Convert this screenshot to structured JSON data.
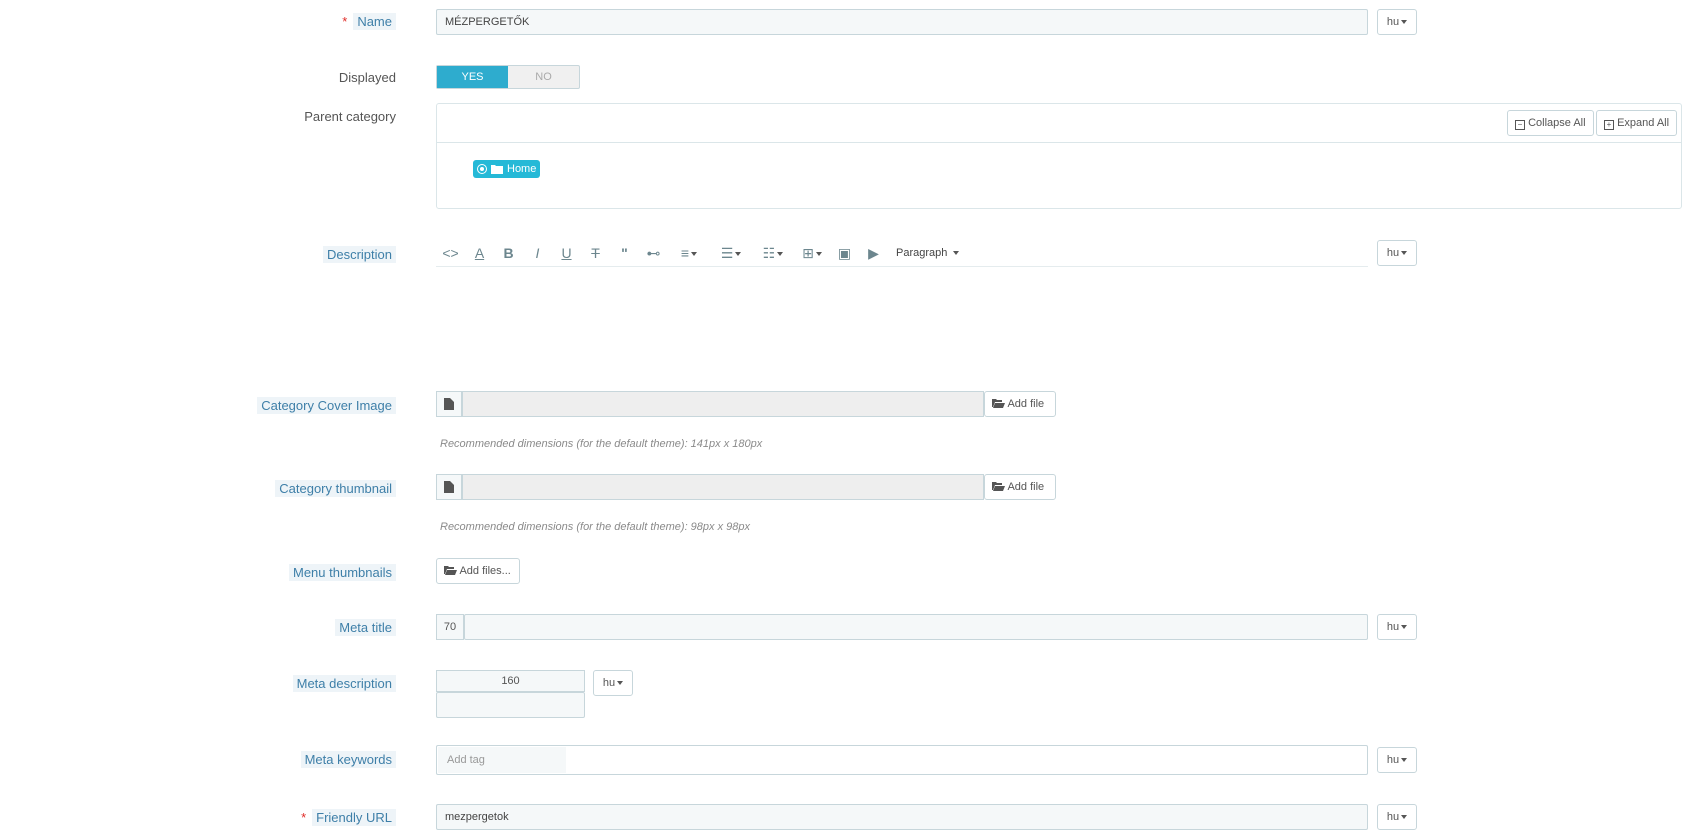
{
  "name": {
    "label": "Name",
    "value": "MÉZPERGETŐK",
    "lang": "hu",
    "required_mark": "*"
  },
  "displayed": {
    "label": "Displayed",
    "yes": "YES",
    "no": "NO",
    "selected": "YES"
  },
  "parent_category": {
    "label": "Parent category",
    "collapse_all": "Collapse All",
    "expand_all": "Expand All",
    "root": "Home"
  },
  "description": {
    "label": "Description",
    "paragraph": "Paragraph",
    "lang": "hu"
  },
  "cover_image": {
    "label": "Category Cover Image",
    "add_file": "Add file",
    "hint": "Recommended dimensions (for the default theme): 141px x 180px"
  },
  "thumbnail": {
    "label": "Category thumbnail",
    "add_file": "Add file",
    "hint": "Recommended dimensions (for the default theme): 98px x 98px"
  },
  "menu_thumbnails": {
    "label": "Menu thumbnails",
    "add_files": "Add files..."
  },
  "meta_title": {
    "label": "Meta title",
    "counter": "70",
    "value": "",
    "lang": "hu"
  },
  "meta_description": {
    "label": "Meta description",
    "counter": "160",
    "value": "",
    "lang": "hu"
  },
  "meta_keywords": {
    "label": "Meta keywords",
    "placeholder": "Add tag",
    "lang": "hu"
  },
  "friendly_url": {
    "label": "Friendly URL",
    "value": "mezpergetok",
    "lang": "hu",
    "required_mark": "*"
  },
  "colors": {
    "accent": "#25b9d7",
    "switch_on": "#2eacce",
    "required": "#e02b27"
  }
}
